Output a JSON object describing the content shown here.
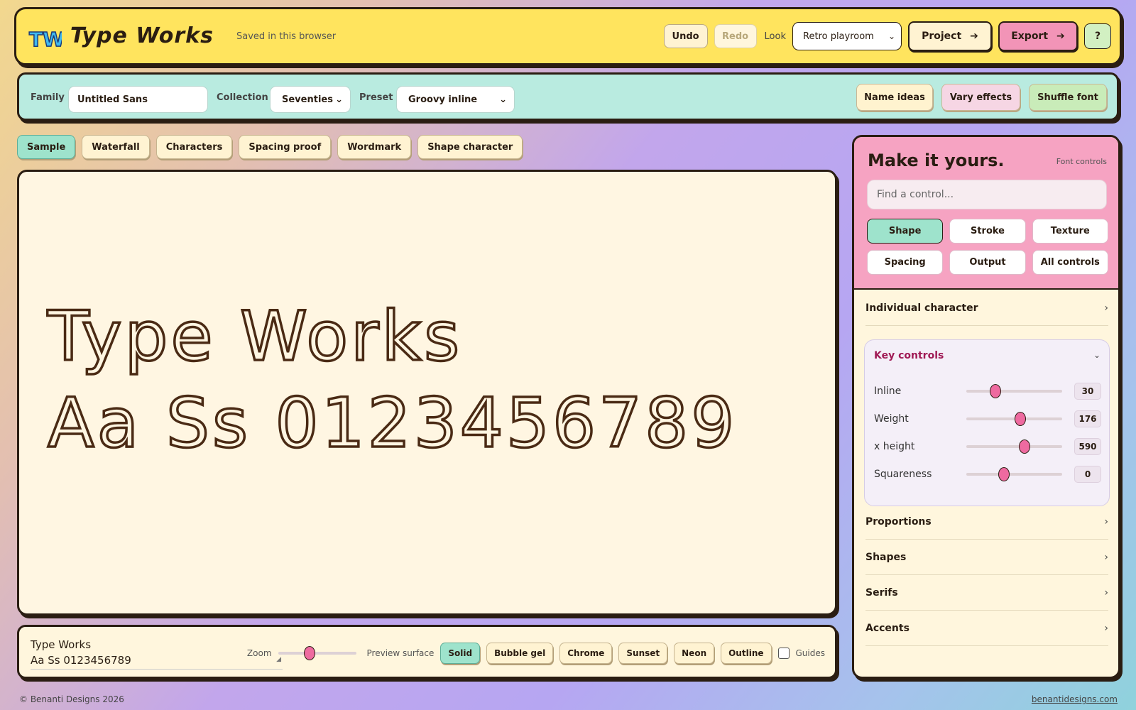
{
  "app": {
    "name": "Type Works",
    "logo_mark": "TW",
    "saved_status": "Saved in this browser"
  },
  "header": {
    "undo": "Undo",
    "redo": "Redo",
    "look_label": "Look",
    "look_value": "Retro playroom",
    "project": "Project",
    "export": "Export",
    "help": "?"
  },
  "toolbar": {
    "family_label": "Family",
    "family_value": "Untitled Sans",
    "collection_label": "Collection",
    "collection_value": "Seventies",
    "preset_label": "Preset",
    "preset_value": "Groovy inline",
    "name_ideas": "Name ideas",
    "vary_effects": "Vary effects",
    "shuffle_font": "Shuffle font"
  },
  "tabs": [
    "Sample",
    "Waterfall",
    "Characters",
    "Spacing proof",
    "Wordmark",
    "Shape character"
  ],
  "active_tab": "Sample",
  "preview": {
    "line1": "Type Works",
    "line2": "Aa Ss 0123456789"
  },
  "bottom": {
    "text_line1": "Type Works",
    "text_line2": "Aa Ss 0123456789",
    "zoom_label": "Zoom",
    "zoom_level": 0.4,
    "surface_label": "Preview surface",
    "surfaces": [
      "Solid",
      "Bubble gel",
      "Chrome",
      "Sunset",
      "Neon",
      "Outline"
    ],
    "active_surface": "Solid",
    "guides_label": "Guides",
    "guides_checked": false
  },
  "panel": {
    "title": "Make it yours.",
    "subtitle": "Font controls",
    "search_placeholder": "Find a control...",
    "categories": [
      "Shape",
      "Stroke",
      "Texture",
      "Spacing",
      "Output",
      "All controls"
    ],
    "active_category": "Shape",
    "individual_character": "Individual character",
    "key_controls": {
      "title": "Key controls",
      "rows": [
        {
          "label": "Inline",
          "value": "30",
          "fraction": 0.3
        },
        {
          "label": "Weight",
          "value": "176",
          "fraction": 0.56
        },
        {
          "label": "x height",
          "value": "590",
          "fraction": 0.61
        },
        {
          "label": "Squareness",
          "value": "0",
          "fraction": 0.39
        }
      ]
    },
    "sections": [
      "Proportions",
      "Shapes",
      "Serifs",
      "Accents"
    ]
  },
  "footer": {
    "copyright": "© Benanti Designs 2026",
    "link": "benantidesigns.com"
  },
  "colors": {
    "header_bg": "#ffe45e",
    "toolbar_bg": "#b9ebe0",
    "active_mint": "#9ee3cc",
    "accent_pink": "#f294b7",
    "canvas_bg": "#fff6e2",
    "slider_thumb": "#ee6aa0",
    "ink": "#2a1d12"
  },
  "icons": {
    "chevron_right": "›",
    "chevron_down": "⌄",
    "arrow": "➔"
  }
}
